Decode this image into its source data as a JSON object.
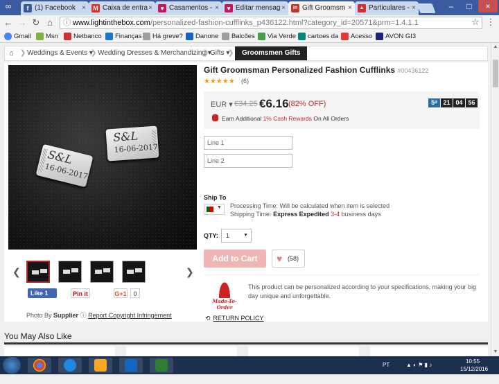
{
  "browser": {
    "tabs": [
      {
        "label": "(1) Facebook",
        "icon": "facebook-icon",
        "color": "#3b5998",
        "glyph": "f",
        "active": false
      },
      {
        "label": "Caixa de entra",
        "icon": "gmail-icon",
        "color": "#d93025",
        "glyph": "M",
        "active": false
      },
      {
        "label": "Casamentos -",
        "icon": "heart-icon",
        "color": "#c2185b",
        "glyph": "♥",
        "active": false
      },
      {
        "label": "Editar mensag",
        "icon": "heart-icon",
        "color": "#c2185b",
        "glyph": "♥",
        "active": false
      },
      {
        "label": "Gift Groomsm",
        "icon": "lightinthebox-icon",
        "color": "#c0392b",
        "glyph": "in",
        "active": true
      },
      {
        "label": "Particulares -",
        "icon": "car-icon",
        "color": "#d32f2f",
        "glyph": "▲",
        "active": false
      }
    ],
    "url_host": "www.lightinthebox.com",
    "url_path": "/personalized-fashion-cufflinks_p436122.html?category_id=20571&prm=1.4.1.1",
    "bookmarks": [
      {
        "label": "Gmail",
        "icon": "google-icon",
        "color": "#4285f4"
      },
      {
        "label": "Msn",
        "icon": "msn-icon",
        "color": "#7cb342"
      },
      {
        "label": "Netbanco",
        "icon": "netbanco-icon",
        "color": "#d32f2f"
      },
      {
        "label": "Finanças",
        "icon": "finance-icon",
        "color": "#1976d2"
      },
      {
        "label": "Há greve?",
        "icon": "document-icon",
        "color": "#9e9e9e"
      },
      {
        "label": "Danone",
        "icon": "danone-icon",
        "color": "#1565c0"
      },
      {
        "label": "Balcões",
        "icon": "document-icon",
        "color": "#9e9e9e"
      },
      {
        "label": "Via Verde",
        "icon": "viaverde-icon",
        "color": "#43a047"
      },
      {
        "label": "cartoes da",
        "icon": "card-icon",
        "color": "#00897b"
      },
      {
        "label": "Acesso",
        "icon": "access-icon",
        "color": "#e53935"
      },
      {
        "label": "AVON GI3",
        "icon": "avon-icon",
        "color": "#1a237e"
      }
    ]
  },
  "breadcrumb": {
    "items": [
      "Weddings & Events",
      "Wedding Dresses & Merchandizing",
      "Gifts"
    ],
    "current": "Groomsmen Gifts"
  },
  "product": {
    "title": "Gift Groomsman Personalized Fashion Cufflinks",
    "sku": "#00436122",
    "stars": "★★★★★",
    "reviews": "(6)",
    "currency": "EUR",
    "old_price": "€34.25",
    "price": "€6.16",
    "discount": "(82% OFF)",
    "cash_prefix": "Earn Additional",
    "cash_highlight": "1% Cash Rewards",
    "cash_suffix": "On All Orders",
    "timer": {
      "days": "5",
      "days_unit": "d",
      "hours": "21",
      "minutes": "04",
      "seconds": "56"
    },
    "line1_placeholder": "Line 1",
    "line2_placeholder": "Line 2",
    "ship_to_label": "Ship To",
    "processing": "Processing Time: Will be calculated when item is selected",
    "shipping_prefix": "Shipping Time:",
    "shipping_method": "Express Expedited",
    "shipping_days": "3-4",
    "shipping_suffix": "business days",
    "qty_label": "QTY:",
    "qty_value": "1",
    "add_to_cart": "Add to Cart",
    "wishlist_count": "(58)",
    "made_to_order": "Made-To-Order",
    "personal_text": "This product can be personalized according to your specifications, making your big day unique and unforgettable.",
    "return_policy": "RETURN POLICY",
    "engraving_initials": "S&L",
    "engraving_date": "16-06-2017"
  },
  "social": {
    "like": "Like 1",
    "pinit": "Pin it",
    "gplus": "G+1",
    "gplus_count": "0"
  },
  "photo_credit": {
    "prefix": "Photo By",
    "supplier": "Supplier",
    "report": "Report Copyright Infringement"
  },
  "also_like": "You May Also Like",
  "taskbar": {
    "language": "PT",
    "time": "10:55",
    "date": "15/12/2016"
  }
}
